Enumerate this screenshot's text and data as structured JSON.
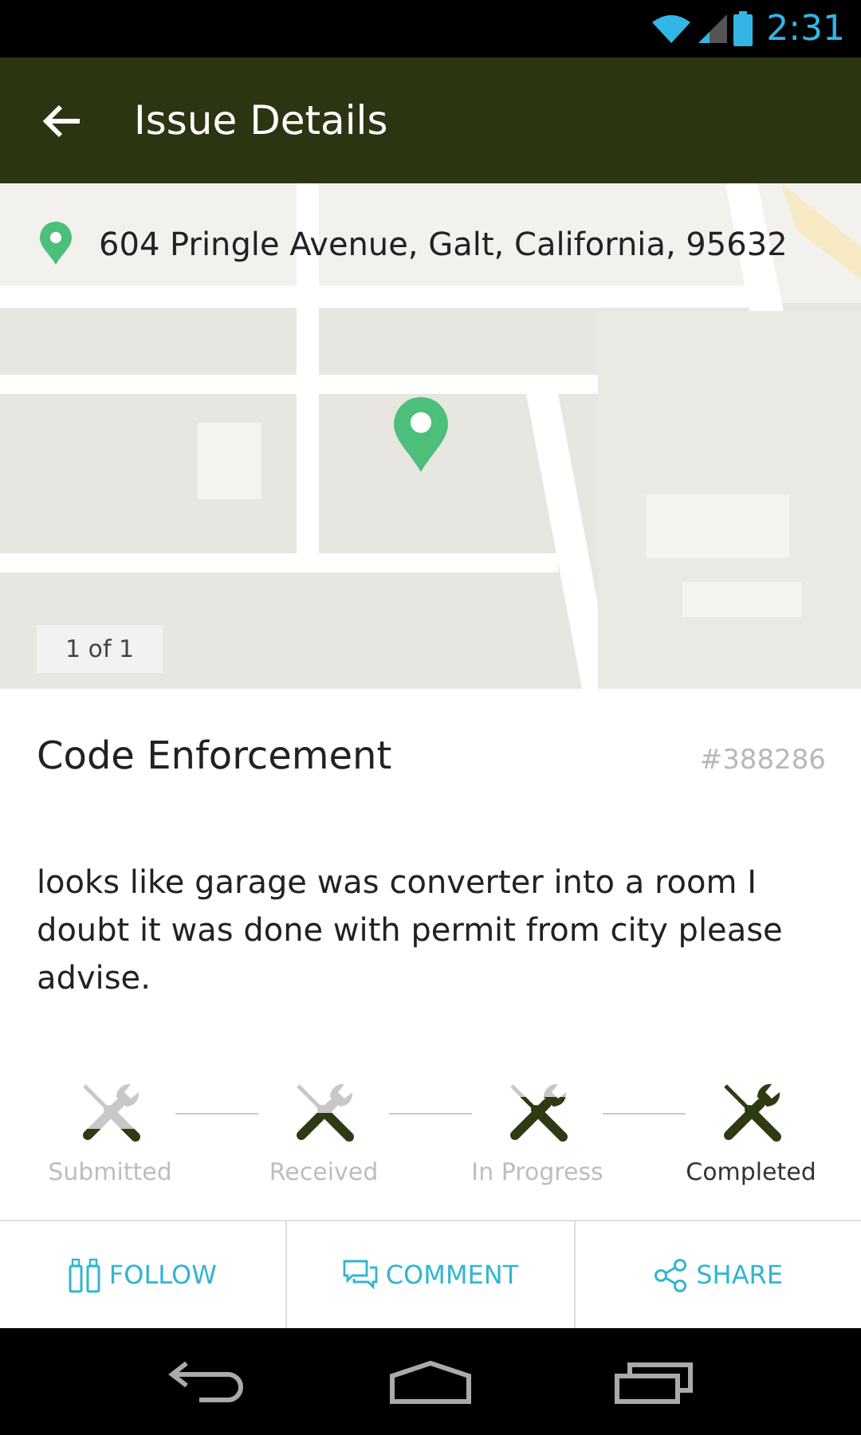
{
  "status_bar": {
    "time": "2:31"
  },
  "app_bar": {
    "title": "Issue Details"
  },
  "map": {
    "address": "604  Pringle Avenue, Galt, California, 95632",
    "counter": "1 of 1"
  },
  "issue": {
    "category": "Code Enforcement",
    "number": "#388286",
    "description": "looks like garage was converter into a room I doubt it was done with permit from city please advise."
  },
  "steps": [
    {
      "label": "Submitted",
      "selected": false
    },
    {
      "label": "Received",
      "selected": false
    },
    {
      "label": "In Progress",
      "selected": false
    },
    {
      "label": "Completed",
      "selected": true
    }
  ],
  "actions": [
    {
      "kind": "follow",
      "label": "FOLLOW"
    },
    {
      "kind": "comment",
      "label": "COMMENT"
    },
    {
      "kind": "share",
      "label": "SHARE"
    }
  ]
}
